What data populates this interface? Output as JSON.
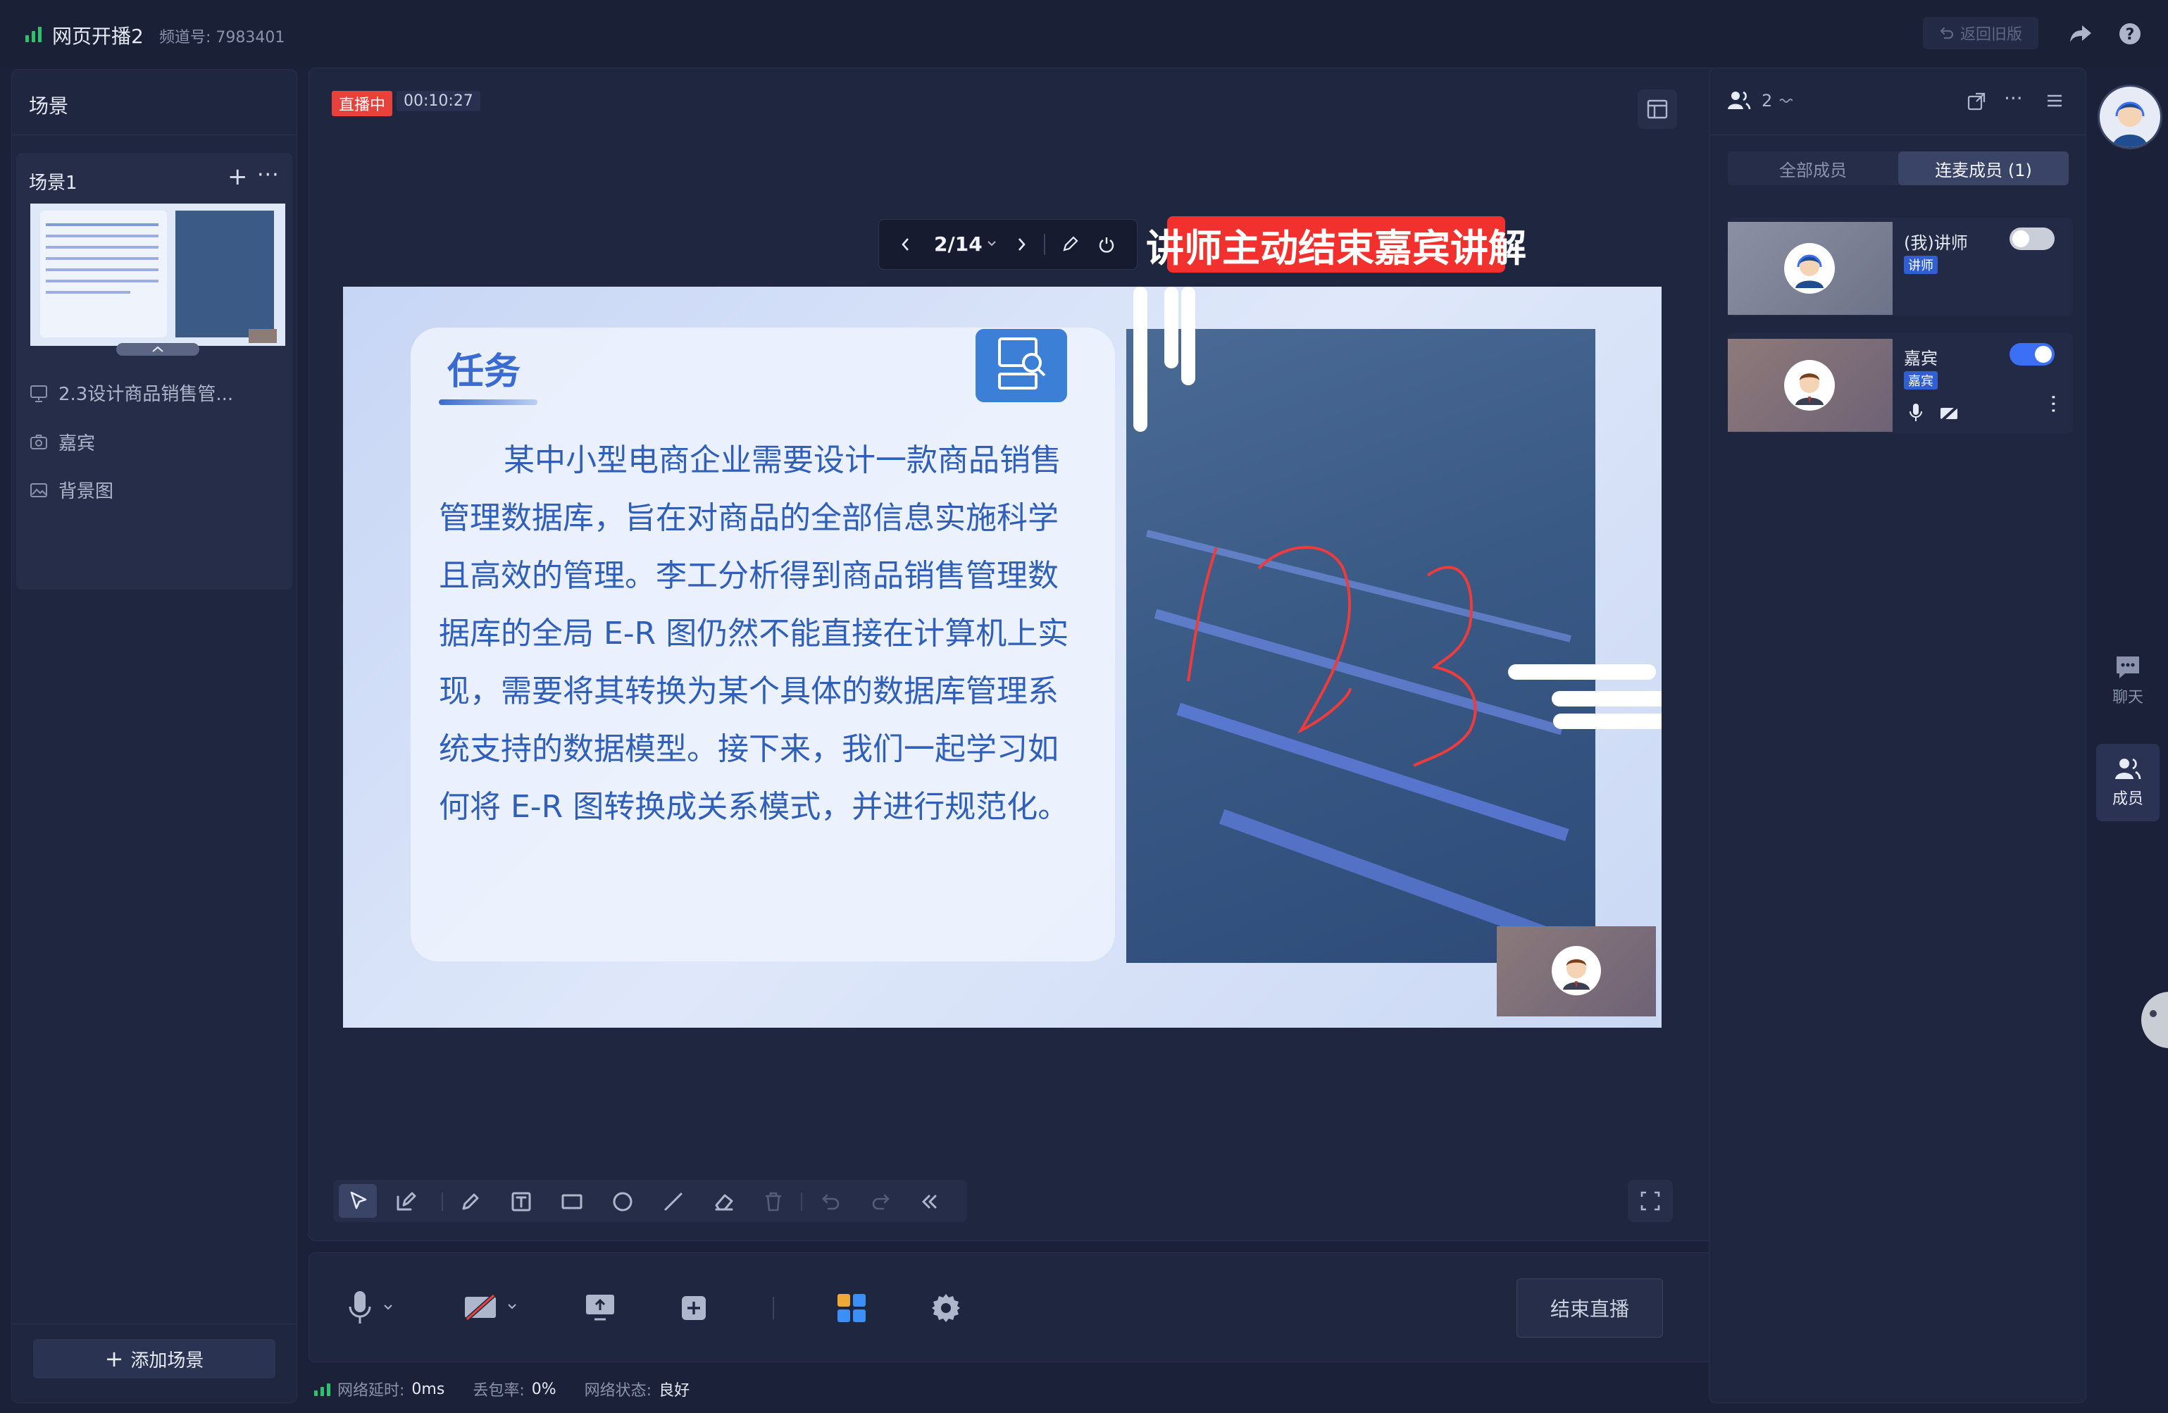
{
  "topbar": {
    "title": "网页开播2",
    "channel": "频道号: 7983401",
    "back_old": "返回旧版"
  },
  "scene_panel": {
    "header": "场景",
    "scene_name": "场景1",
    "items": [
      {
        "icon": "presentation-icon",
        "label": "2.3设计商品销售管..."
      },
      {
        "icon": "camera-icon",
        "label": "嘉宾"
      },
      {
        "icon": "image-icon",
        "label": "背景图"
      }
    ],
    "add_scene": "添加场景"
  },
  "stage": {
    "live_badge": "直播中",
    "live_time": "00:10:27",
    "page_indicator": "2/14",
    "overlay_banner": "讲师主动结束嘉宾讲解"
  },
  "slide": {
    "heading": "任务",
    "paragraph": "某中小型电商企业需要设计一款商品销售管理数据库，旨在对商品的全部信息实施科学且高效的管理。李工分析得到商品销售管理数据库的全局 E-R 图仍然不能直接在计算机上实现，需要将其转换为某个具体的数据库管理系统支持的数据模型。接下来，我们一起学习如何将 E-R 图转换成关系模式，并进行规范化。"
  },
  "controls": {
    "end_live": "结束直播"
  },
  "status": {
    "latency_label": "网络延时:",
    "latency_value": "0ms",
    "loss_label": "丢包率:",
    "loss_value": "0%",
    "net_label": "网络状态:",
    "net_value": "良好"
  },
  "members": {
    "count": "2",
    "tabs": [
      "全部成员",
      "连麦成员 (1)"
    ],
    "list": [
      {
        "name": "(我)讲师",
        "role": "讲师",
        "toggle_on": false
      },
      {
        "name": "嘉宾",
        "role": "嘉宾",
        "toggle_on": true
      }
    ]
  },
  "side_nav": {
    "chat": "聊天",
    "members": "成员"
  },
  "colors": {
    "accent": "#3b6ff5",
    "live_red": "#e8413c",
    "banner_red": "#f2302d",
    "signal_green": "#2ec26b"
  }
}
